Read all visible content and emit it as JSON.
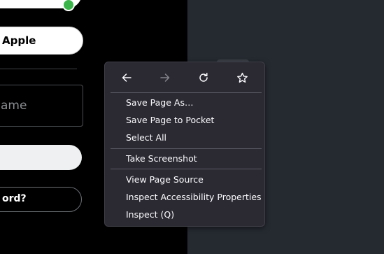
{
  "left_panel": {
    "apple_button_label": "Apple",
    "name_placeholder": "ame",
    "forgot_button_label": "ord?"
  },
  "context_menu": {
    "nav": {
      "back_icon": "arrow-left-icon",
      "forward_icon": "arrow-right-icon",
      "reload_icon": "reload-icon",
      "bookmark_icon": "star-icon"
    },
    "items": [
      {
        "label": "Save Page As…"
      },
      {
        "label": "Save Page to Pocket"
      },
      {
        "label": "Select All"
      },
      {
        "label": "Take Screenshot"
      },
      {
        "label": "View Page Source"
      },
      {
        "label": "Inspect Accessibility Properties"
      },
      {
        "label": "Inspect (Q)"
      }
    ]
  },
  "colors": {
    "page_background": "#252a31",
    "left_panel_background": "#000000",
    "menu_background": "#2b2a33",
    "menu_text": "#fbfbfe",
    "status_green": "#3bb54a"
  }
}
